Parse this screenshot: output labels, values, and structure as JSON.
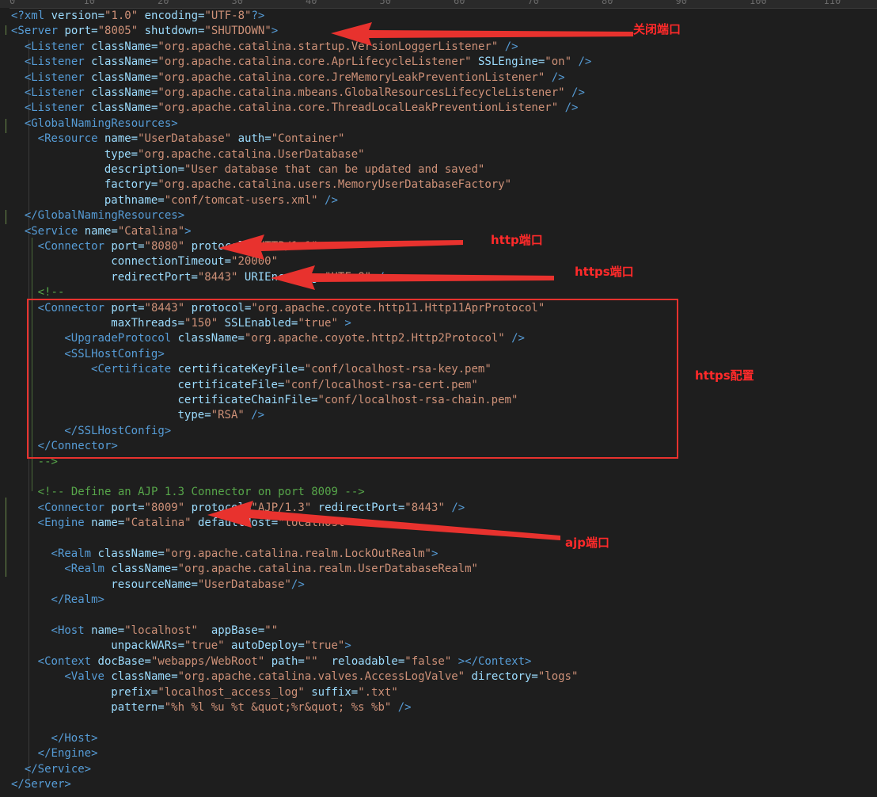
{
  "ruler": {
    "ticks": [
      "0",
      "10",
      "20",
      "30",
      "40",
      "50",
      "60",
      "70",
      "80",
      "90",
      "100",
      "110"
    ]
  },
  "lines": [
    {
      "i": 0,
      "segs": [
        [
          "t",
          "<?xml "
        ],
        [
          "a",
          "version="
        ],
        [
          "v",
          "\"1.0\" "
        ],
        [
          "a",
          "encoding="
        ],
        [
          "v",
          "\"UTF-8\""
        ],
        [
          "t",
          "?>"
        ]
      ]
    },
    {
      "i": 0,
      "segs": [
        [
          "t",
          "<Server "
        ],
        [
          "a",
          "port="
        ],
        [
          "v",
          "\"8005\" "
        ],
        [
          "a",
          "shutdown="
        ],
        [
          "v",
          "\"SHUTDOWN\""
        ],
        [
          "t",
          ">"
        ]
      ]
    },
    {
      "i": 2,
      "segs": [
        [
          "t",
          "<Listener "
        ],
        [
          "a",
          "className="
        ],
        [
          "v",
          "\"org.apache.catalina.startup.VersionLoggerListener\" "
        ],
        [
          "t",
          "/>"
        ]
      ]
    },
    {
      "i": 2,
      "segs": [
        [
          "t",
          "<Listener "
        ],
        [
          "a",
          "className="
        ],
        [
          "v",
          "\"org.apache.catalina.core.AprLifecycleListener\" "
        ],
        [
          "a",
          "SSLEngine="
        ],
        [
          "v",
          "\"on\" "
        ],
        [
          "t",
          "/>"
        ]
      ]
    },
    {
      "i": 2,
      "segs": [
        [
          "t",
          "<Listener "
        ],
        [
          "a",
          "className="
        ],
        [
          "v",
          "\"org.apache.catalina.core.JreMemoryLeakPreventionListener\" "
        ],
        [
          "t",
          "/>"
        ]
      ]
    },
    {
      "i": 2,
      "segs": [
        [
          "t",
          "<Listener "
        ],
        [
          "a",
          "className="
        ],
        [
          "v",
          "\"org.apache.catalina.mbeans.GlobalResourcesLifecycleListener\" "
        ],
        [
          "t",
          "/>"
        ]
      ]
    },
    {
      "i": 2,
      "segs": [
        [
          "t",
          "<Listener "
        ],
        [
          "a",
          "className="
        ],
        [
          "v",
          "\"org.apache.catalina.core.ThreadLocalLeakPreventionListener\" "
        ],
        [
          "t",
          "/>"
        ]
      ]
    },
    {
      "i": 2,
      "segs": [
        [
          "t",
          "<GlobalNamingResources>"
        ]
      ]
    },
    {
      "i": 4,
      "segs": [
        [
          "t",
          "<Resource "
        ],
        [
          "a",
          "name="
        ],
        [
          "v",
          "\"UserDatabase\" "
        ],
        [
          "a",
          "auth="
        ],
        [
          "v",
          "\"Container\""
        ]
      ]
    },
    {
      "i": 14,
      "segs": [
        [
          "a",
          "type="
        ],
        [
          "v",
          "\"org.apache.catalina.UserDatabase\""
        ]
      ]
    },
    {
      "i": 14,
      "segs": [
        [
          "a",
          "description="
        ],
        [
          "v",
          "\"User database that can be updated and saved\""
        ]
      ]
    },
    {
      "i": 14,
      "segs": [
        [
          "a",
          "factory="
        ],
        [
          "v",
          "\"org.apache.catalina.users.MemoryUserDatabaseFactory\""
        ]
      ]
    },
    {
      "i": 14,
      "segs": [
        [
          "a",
          "pathname="
        ],
        [
          "v",
          "\"conf/tomcat-users.xml\" "
        ],
        [
          "t",
          "/>"
        ]
      ]
    },
    {
      "i": 2,
      "segs": [
        [
          "t",
          "</GlobalNamingResources>"
        ]
      ]
    },
    {
      "i": 2,
      "segs": [
        [
          "t",
          "<Service "
        ],
        [
          "a",
          "name="
        ],
        [
          "v",
          "\"Catalina\""
        ],
        [
          "t",
          ">"
        ]
      ]
    },
    {
      "i": 4,
      "segs": [
        [
          "t",
          "<Connector "
        ],
        [
          "a",
          "port="
        ],
        [
          "v",
          "\"8080\" "
        ],
        [
          "a",
          "protocol="
        ],
        [
          "v",
          "\"HTTP/1.1\""
        ]
      ]
    },
    {
      "i": 15,
      "segs": [
        [
          "a",
          "connectionTimeout="
        ],
        [
          "v",
          "\"20000\""
        ]
      ]
    },
    {
      "i": 15,
      "segs": [
        [
          "a",
          "redirectPort="
        ],
        [
          "v",
          "\"8443\" "
        ],
        [
          "a",
          "URIEncoding="
        ],
        [
          "v",
          "\"UTF-8\" "
        ],
        [
          "t",
          "/>"
        ]
      ]
    },
    {
      "i": 4,
      "segs": [
        [
          "c",
          "<!--"
        ]
      ]
    },
    {
      "i": 4,
      "segs": [
        [
          "t",
          "<Connector "
        ],
        [
          "a",
          "port="
        ],
        [
          "v",
          "\"8443\" "
        ],
        [
          "a",
          "protocol="
        ],
        [
          "v",
          "\"org.apache.coyote.http11.Http11AprProtocol\""
        ]
      ]
    },
    {
      "i": 15,
      "segs": [
        [
          "a",
          "maxThreads="
        ],
        [
          "v",
          "\"150\" "
        ],
        [
          "a",
          "SSLEnabled="
        ],
        [
          "v",
          "\"true\" "
        ],
        [
          "t",
          ">"
        ]
      ]
    },
    {
      "i": 8,
      "segs": [
        [
          "t",
          "<UpgradeProtocol "
        ],
        [
          "a",
          "className="
        ],
        [
          "v",
          "\"org.apache.coyote.http2.Http2Protocol\" "
        ],
        [
          "t",
          "/>"
        ]
      ]
    },
    {
      "i": 8,
      "segs": [
        [
          "t",
          "<SSLHostConfig>"
        ]
      ]
    },
    {
      "i": 12,
      "segs": [
        [
          "t",
          "<Certificate "
        ],
        [
          "a",
          "certificateKeyFile="
        ],
        [
          "v",
          "\"conf/localhost-rsa-key.pem\""
        ]
      ]
    },
    {
      "i": 25,
      "segs": [
        [
          "a",
          "certificateFile="
        ],
        [
          "v",
          "\"conf/localhost-rsa-cert.pem\""
        ]
      ]
    },
    {
      "i": 25,
      "segs": [
        [
          "a",
          "certificateChainFile="
        ],
        [
          "v",
          "\"conf/localhost-rsa-chain.pem\""
        ]
      ]
    },
    {
      "i": 25,
      "segs": [
        [
          "a",
          "type="
        ],
        [
          "v",
          "\"RSA\" "
        ],
        [
          "t",
          "/>"
        ]
      ]
    },
    {
      "i": 8,
      "segs": [
        [
          "t",
          "</SSLHostConfig>"
        ]
      ]
    },
    {
      "i": 4,
      "segs": [
        [
          "t",
          "</Connector>"
        ]
      ]
    },
    {
      "i": 4,
      "segs": [
        [
          "c",
          "-->"
        ]
      ]
    },
    {
      "i": 0,
      "segs": []
    },
    {
      "i": 4,
      "segs": [
        [
          "c",
          "<!-- Define an AJP 1.3 Connector on port 8009 -->"
        ]
      ]
    },
    {
      "i": 4,
      "segs": [
        [
          "t",
          "<Connector "
        ],
        [
          "a",
          "port="
        ],
        [
          "v",
          "\"8009\" "
        ],
        [
          "a",
          "protocol="
        ],
        [
          "v",
          "\"AJP/1.3\" "
        ],
        [
          "a",
          "redirectPort="
        ],
        [
          "v",
          "\"8443\" "
        ],
        [
          "t",
          "/>"
        ]
      ]
    },
    {
      "i": 4,
      "segs": [
        [
          "t",
          "<Engine "
        ],
        [
          "a",
          "name="
        ],
        [
          "v",
          "\"Catalina\" "
        ],
        [
          "a",
          "defaultHost="
        ],
        [
          "v",
          "\"localhost\""
        ],
        [
          "t",
          ">"
        ]
      ]
    },
    {
      "i": 0,
      "segs": []
    },
    {
      "i": 6,
      "segs": [
        [
          "t",
          "<Realm "
        ],
        [
          "a",
          "className="
        ],
        [
          "v",
          "\"org.apache.catalina.realm.LockOutRealm\""
        ],
        [
          "t",
          ">"
        ]
      ]
    },
    {
      "i": 8,
      "segs": [
        [
          "t",
          "<Realm "
        ],
        [
          "a",
          "className="
        ],
        [
          "v",
          "\"org.apache.catalina.realm.UserDatabaseRealm\""
        ]
      ]
    },
    {
      "i": 15,
      "segs": [
        [
          "a",
          "resourceName="
        ],
        [
          "v",
          "\"UserDatabase\""
        ],
        [
          "t",
          "/>"
        ]
      ]
    },
    {
      "i": 6,
      "segs": [
        [
          "t",
          "</Realm>"
        ]
      ]
    },
    {
      "i": 0,
      "segs": []
    },
    {
      "i": 6,
      "segs": [
        [
          "t",
          "<Host "
        ],
        [
          "a",
          "name="
        ],
        [
          "v",
          "\"localhost\"  "
        ],
        [
          "a",
          "appBase="
        ],
        [
          "v",
          "\"\""
        ]
      ]
    },
    {
      "i": 15,
      "segs": [
        [
          "a",
          "unpackWARs="
        ],
        [
          "v",
          "\"true\" "
        ],
        [
          "a",
          "autoDeploy="
        ],
        [
          "v",
          "\"true\""
        ],
        [
          "t",
          ">"
        ]
      ]
    },
    {
      "i": 4,
      "segs": [
        [
          "t",
          "<Context "
        ],
        [
          "a",
          "docBase="
        ],
        [
          "v",
          "\"webapps/WebRoot\" "
        ],
        [
          "a",
          "path="
        ],
        [
          "v",
          "\"\"  "
        ],
        [
          "a",
          "reloadable="
        ],
        [
          "v",
          "\"false\" "
        ],
        [
          "t",
          "></Context>"
        ]
      ]
    },
    {
      "i": 8,
      "segs": [
        [
          "t",
          "<Valve "
        ],
        [
          "a",
          "className="
        ],
        [
          "v",
          "\"org.apache.catalina.valves.AccessLogValve\" "
        ],
        [
          "a",
          "directory="
        ],
        [
          "v",
          "\"logs\""
        ]
      ]
    },
    {
      "i": 15,
      "segs": [
        [
          "a",
          "prefix="
        ],
        [
          "v",
          "\"localhost_access_log\" "
        ],
        [
          "a",
          "suffix="
        ],
        [
          "v",
          "\".txt\""
        ]
      ]
    },
    {
      "i": 15,
      "segs": [
        [
          "a",
          "pattern="
        ],
        [
          "v",
          "\"%h %l %u %t &quot;%r&quot; %s %b\" "
        ],
        [
          "t",
          "/>"
        ]
      ]
    },
    {
      "i": 0,
      "segs": []
    },
    {
      "i": 6,
      "segs": [
        [
          "t",
          "</Host>"
        ]
      ]
    },
    {
      "i": 4,
      "segs": [
        [
          "t",
          "</Engine>"
        ]
      ]
    },
    {
      "i": 2,
      "segs": [
        [
          "t",
          "</Service>"
        ]
      ]
    },
    {
      "i": 0,
      "segs": [
        [
          "t",
          "</Server>"
        ]
      ]
    }
  ],
  "annotations": {
    "shutdown_port": "关闭端口",
    "http_port": "http端口",
    "https_port": "https端口",
    "https_config": "https配置",
    "ajp_port": "ajp端口"
  },
  "colors": {
    "tag": "#569cd6",
    "attribute": "#9cdcfe",
    "value": "#ce9178",
    "comment": "#57a64a",
    "annotation": "#ff2a2a"
  }
}
